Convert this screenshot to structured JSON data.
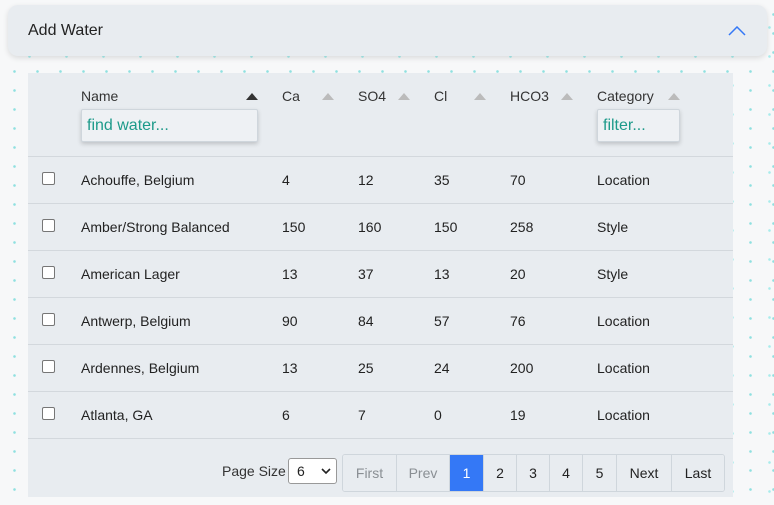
{
  "accordion": {
    "title": "Add Water"
  },
  "table": {
    "columns": [
      {
        "label": "Name"
      },
      {
        "label": "Ca"
      },
      {
        "label": "SO4"
      },
      {
        "label": "Cl"
      },
      {
        "label": "HCO3"
      },
      {
        "label": "Category"
      }
    ],
    "name_filter_placeholder": "find water...",
    "category_filter_placeholder": "filter...",
    "rows": [
      {
        "name": "Achouffe, Belgium",
        "ca": "4",
        "so4": "12",
        "cl": "35",
        "hco3": "70",
        "category": "Location"
      },
      {
        "name": "Amber/Strong Balanced",
        "ca": "150",
        "so4": "160",
        "cl": "150",
        "hco3": "258",
        "category": "Style"
      },
      {
        "name": "American Lager",
        "ca": "13",
        "so4": "37",
        "cl": "13",
        "hco3": "20",
        "category": "Style"
      },
      {
        "name": "Antwerp, Belgium",
        "ca": "90",
        "so4": "84",
        "cl": "57",
        "hco3": "76",
        "category": "Location"
      },
      {
        "name": "Ardennes, Belgium",
        "ca": "13",
        "so4": "25",
        "cl": "24",
        "hco3": "200",
        "category": "Location"
      },
      {
        "name": "Atlanta, GA",
        "ca": "6",
        "so4": "7",
        "cl": "0",
        "hco3": "19",
        "category": "Location"
      }
    ]
  },
  "pagination": {
    "page_size_label": "Page Size",
    "page_size_value": "6",
    "first": "First",
    "prev": "Prev",
    "pages": [
      "1",
      "2",
      "3",
      "4",
      "5"
    ],
    "next": "Next",
    "last": "Last",
    "current_page": "1",
    "active_color": "#3478f6"
  }
}
